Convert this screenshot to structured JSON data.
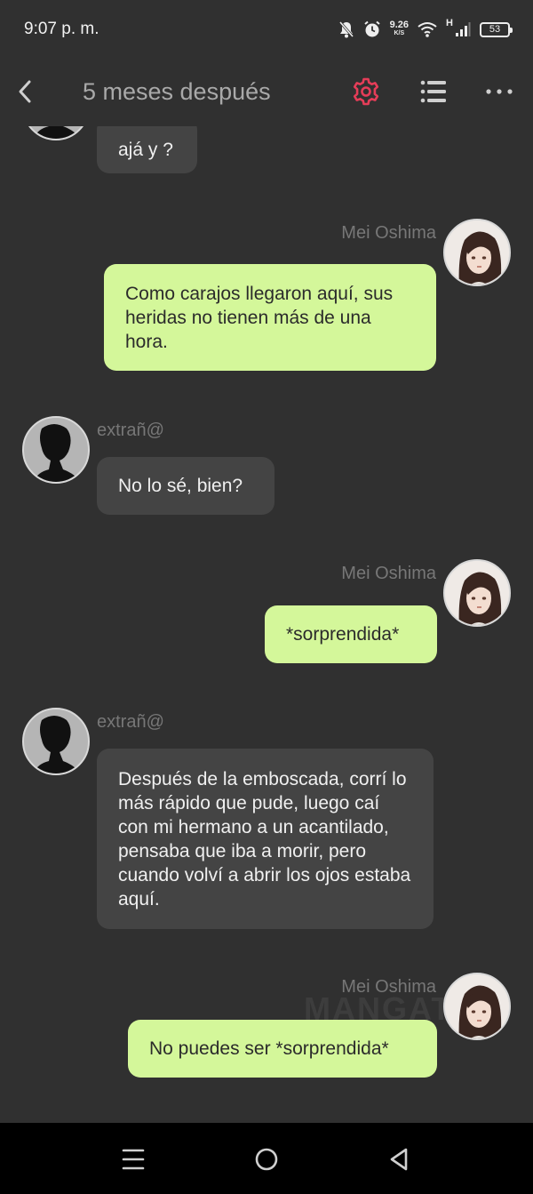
{
  "status_bar": {
    "time": "9:07 p. m.",
    "speed_value": "9.26",
    "speed_unit": "K/S",
    "network": "H",
    "battery": "53"
  },
  "header": {
    "title": "5 meses después",
    "accent_color": "#e53d58"
  },
  "messages": [
    {
      "side": "in",
      "sender": "",
      "text": "ajá y ?"
    },
    {
      "side": "out",
      "sender": "Mei Oshima",
      "text": "Como carajos llegaron aquí, sus heridas no tienen más de una hora."
    },
    {
      "side": "in",
      "sender": "extrañ@",
      "text": "No lo sé, bien?"
    },
    {
      "side": "out",
      "sender": "Mei Oshima",
      "text": "*sorprendida*"
    },
    {
      "side": "in",
      "sender": "extrañ@",
      "text": "Después de la emboscada, corrí lo más rápido que pude, luego caí con mi hermano a un acantilado, pensaba que iba a morir, pero cuando volví a abrir los ojos estaba aquí."
    },
    {
      "side": "out",
      "sender": "Mei Oshima",
      "text": "No puedes ser *sorprendida*"
    }
  ],
  "watermark": "MANGATO",
  "colors": {
    "background": "#303030",
    "incoming_bubble": "#444444",
    "outgoing_bubble": "#d4f79a"
  },
  "icons": {
    "back": "chevron-left-icon",
    "settings": "gear-icon",
    "list": "list-icon",
    "more": "more-dots-icon",
    "nav_menu": "menu-icon",
    "nav_home": "home-circle-icon",
    "nav_back": "triangle-back-icon"
  }
}
